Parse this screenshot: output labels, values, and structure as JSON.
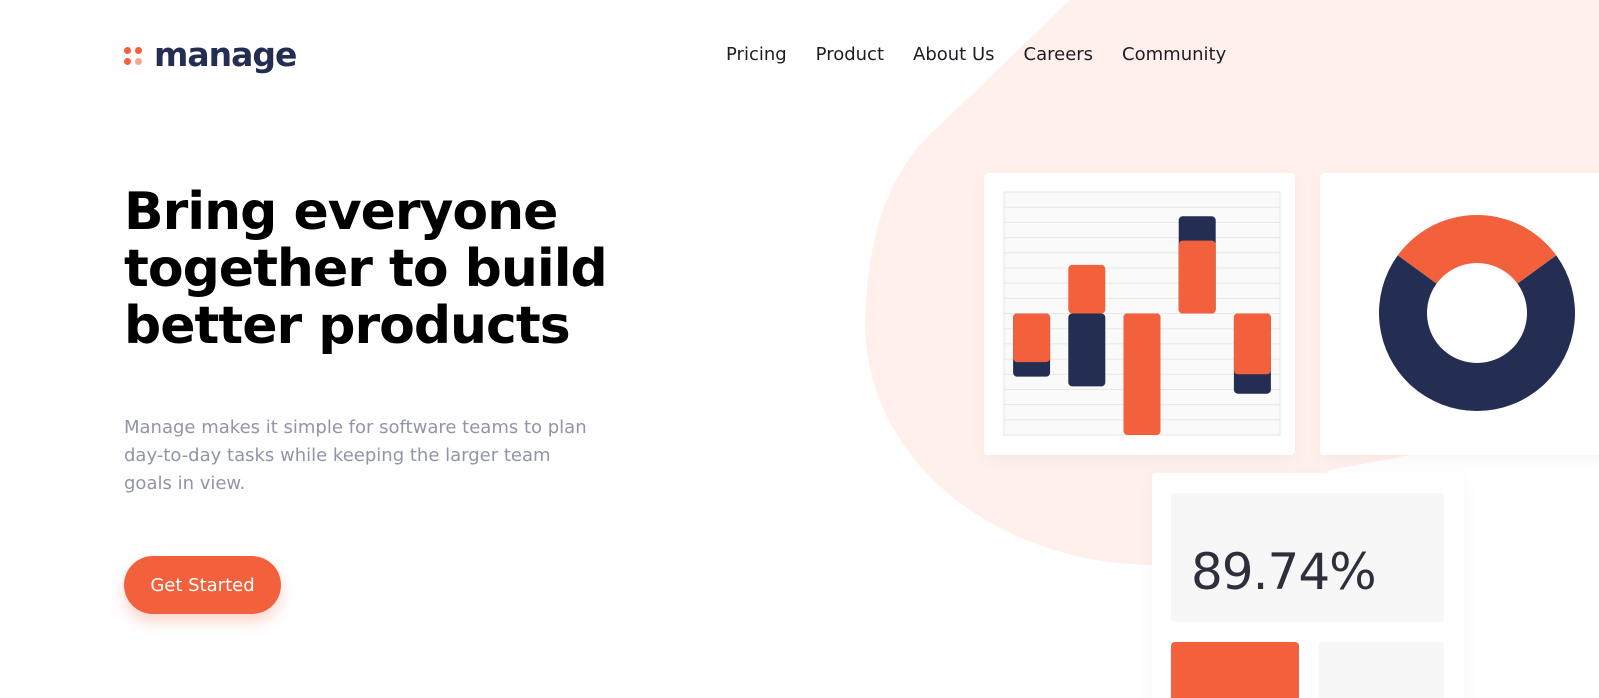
{
  "brand": {
    "name": "manage",
    "colors": {
      "accent": "#f3603c",
      "accent_light": "#f8a48f",
      "navy": "#242d52",
      "blob": "#fff0ec"
    }
  },
  "nav": {
    "items": [
      "Pricing",
      "Product",
      "About Us",
      "Careers",
      "Community"
    ]
  },
  "hero": {
    "title_lines": [
      "Bring everyone",
      "together to build",
      "better products"
    ],
    "text": "Manage makes it simple for software teams to plan day-to-day tasks while keeping the larger team goals in view.",
    "cta_label": "Get Started"
  },
  "stat_card": {
    "value": "89.74%"
  },
  "chart_data": [
    {
      "type": "bar",
      "series": [
        {
          "name": "",
          "color": "#f3603c",
          "values": [
            -2,
            2,
            -5,
            3,
            -2.5
          ]
        },
        {
          "name": "",
          "color": "#242d52",
          "values": [
            -2.6,
            -3,
            -2,
            4,
            -3.3
          ]
        }
      ],
      "categories": [
        "",
        "",
        "",
        "",
        ""
      ],
      "ylim": [
        -5,
        5
      ],
      "grid": true
    },
    {
      "type": "pie",
      "style": "donut",
      "values": [
        30,
        70
      ],
      "colors": [
        "#f3603c",
        "#242d52"
      ]
    }
  ]
}
